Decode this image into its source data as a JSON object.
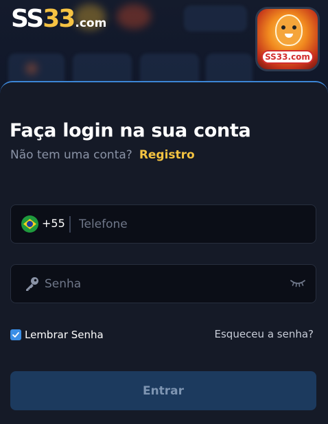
{
  "header": {
    "logo": {
      "part1": "SS",
      "part2": "33",
      "part3": ".com"
    },
    "app_icon": {
      "label": "SS33.com"
    }
  },
  "login": {
    "title": "Faça login na sua conta",
    "no_account_text": "Não tem uma conta?",
    "register_link": "Registro",
    "phone": {
      "country_code": "+55",
      "placeholder": "Telefone",
      "value": ""
    },
    "password": {
      "placeholder": "Senha",
      "value": ""
    },
    "remember_label": "Lembrar Senha",
    "remember_checked": true,
    "forgot_link": "Esqueceu a senha?",
    "submit_label": "Entrar"
  },
  "icons": {
    "country_flag": "brazil-flag-icon",
    "password": "key-icon",
    "visibility": "eye-closed-icon",
    "checkbox": "check-icon"
  },
  "colors": {
    "accent_blue": "#3a8ee6",
    "link_yellow": "#f4c341",
    "panel_bg": "#151a27",
    "button_bg": "#1c3a5e"
  }
}
